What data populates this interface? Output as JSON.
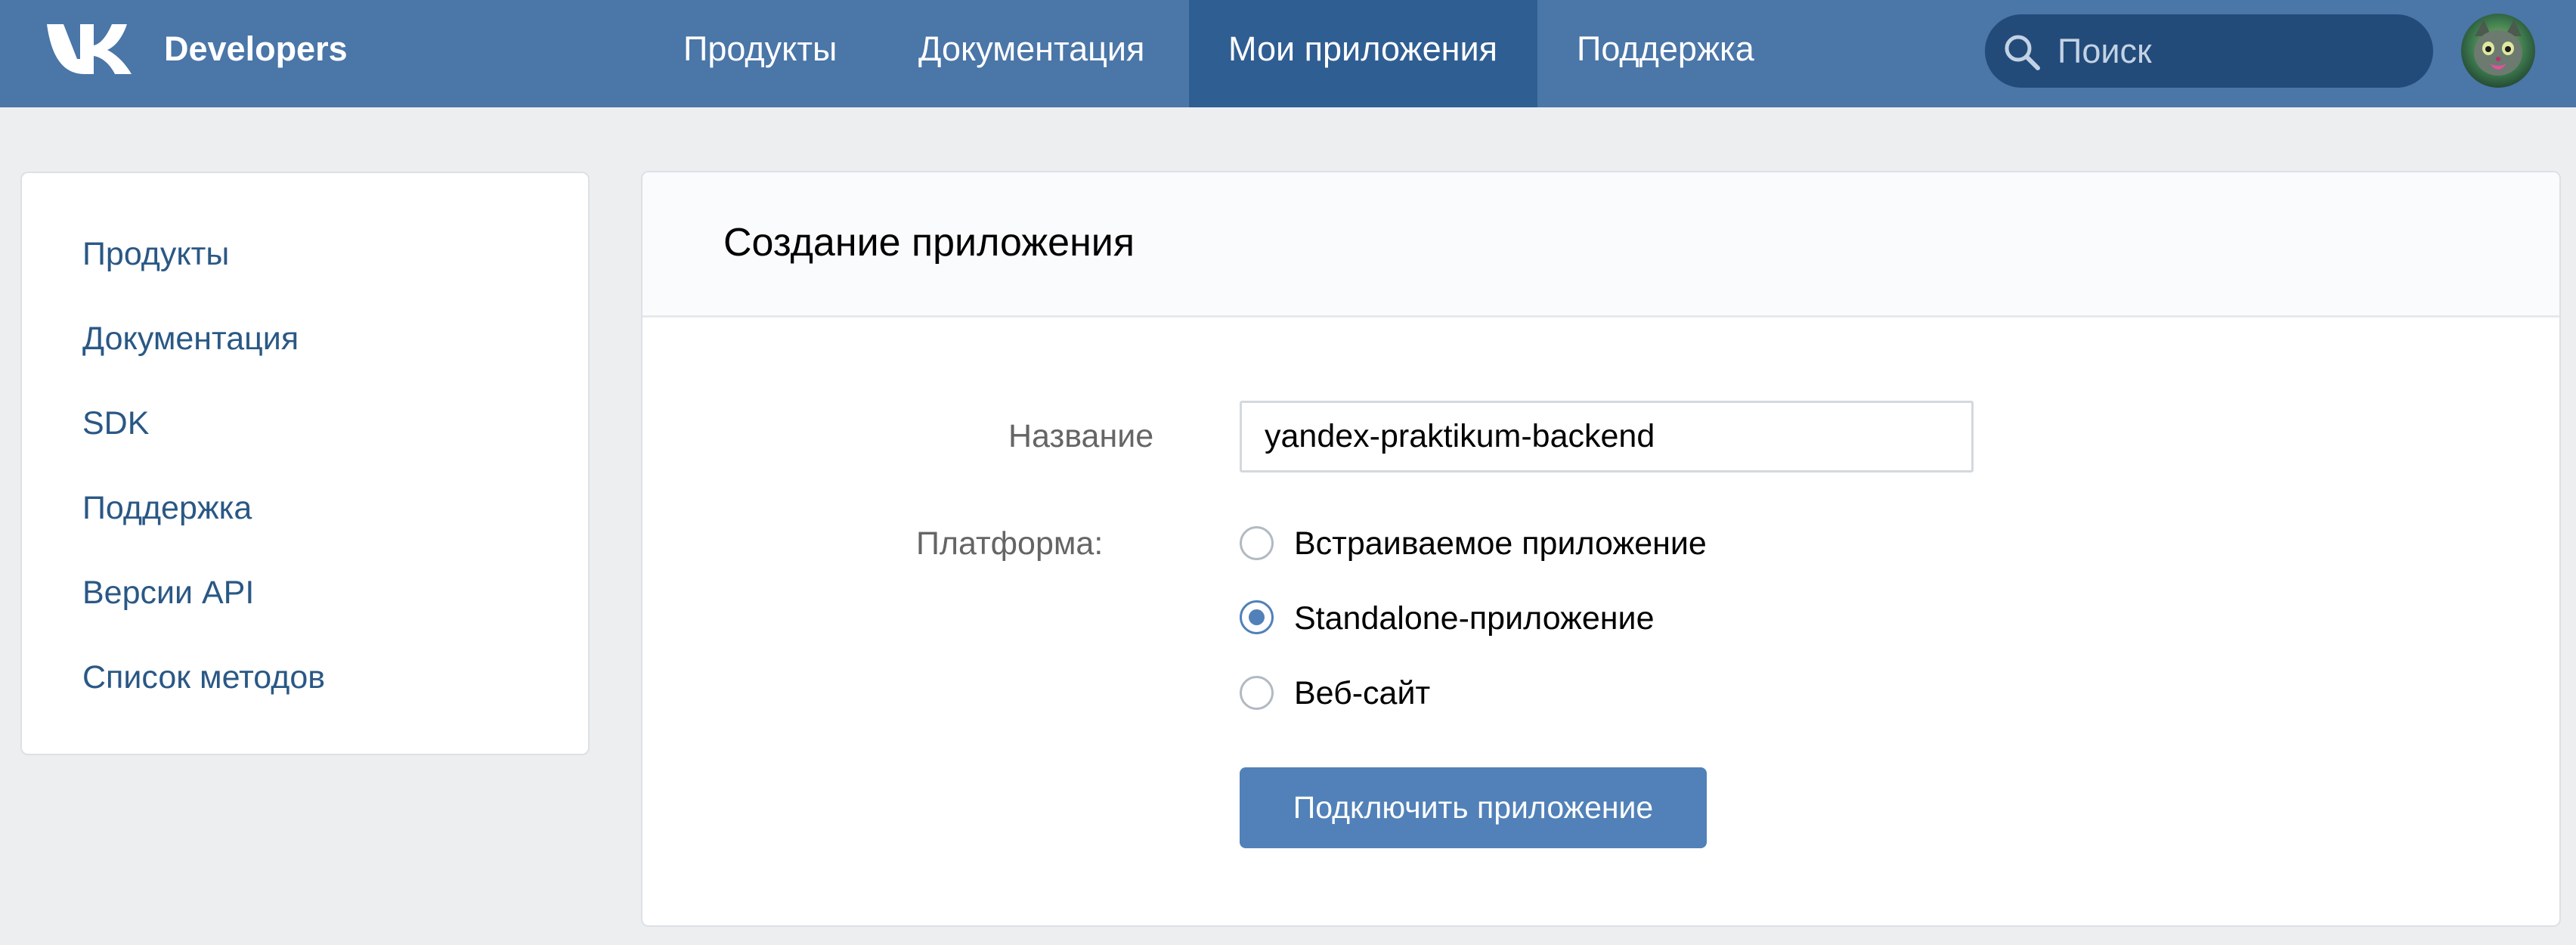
{
  "header": {
    "brand": "Developers",
    "nav": [
      "Продукты",
      "Документация",
      "Мои приложения",
      "Поддержка"
    ],
    "active_nav": "Мои приложения",
    "search_placeholder": "Поиск",
    "colors": {
      "bar": "#4a76a8",
      "active_tab": "#2f5e93",
      "search_bg": "#224b7a"
    }
  },
  "sidebar": {
    "items": [
      "Продукты",
      "Документация",
      "SDK",
      "Поддержка",
      "Версии API",
      "Список методов"
    ]
  },
  "main": {
    "title": "Создание приложения",
    "form": {
      "name_label": "Название",
      "name_value": "yandex-praktikum-backend",
      "platform_label": "Платформа:",
      "platforms": [
        "Встраиваемое приложение",
        "Standalone-приложение",
        "Веб-сайт"
      ],
      "selected_platform": "Standalone-приложение",
      "submit_label": "Подключить приложение"
    }
  },
  "icons": [
    "vk-logo-icon",
    "search-icon",
    "avatar"
  ]
}
